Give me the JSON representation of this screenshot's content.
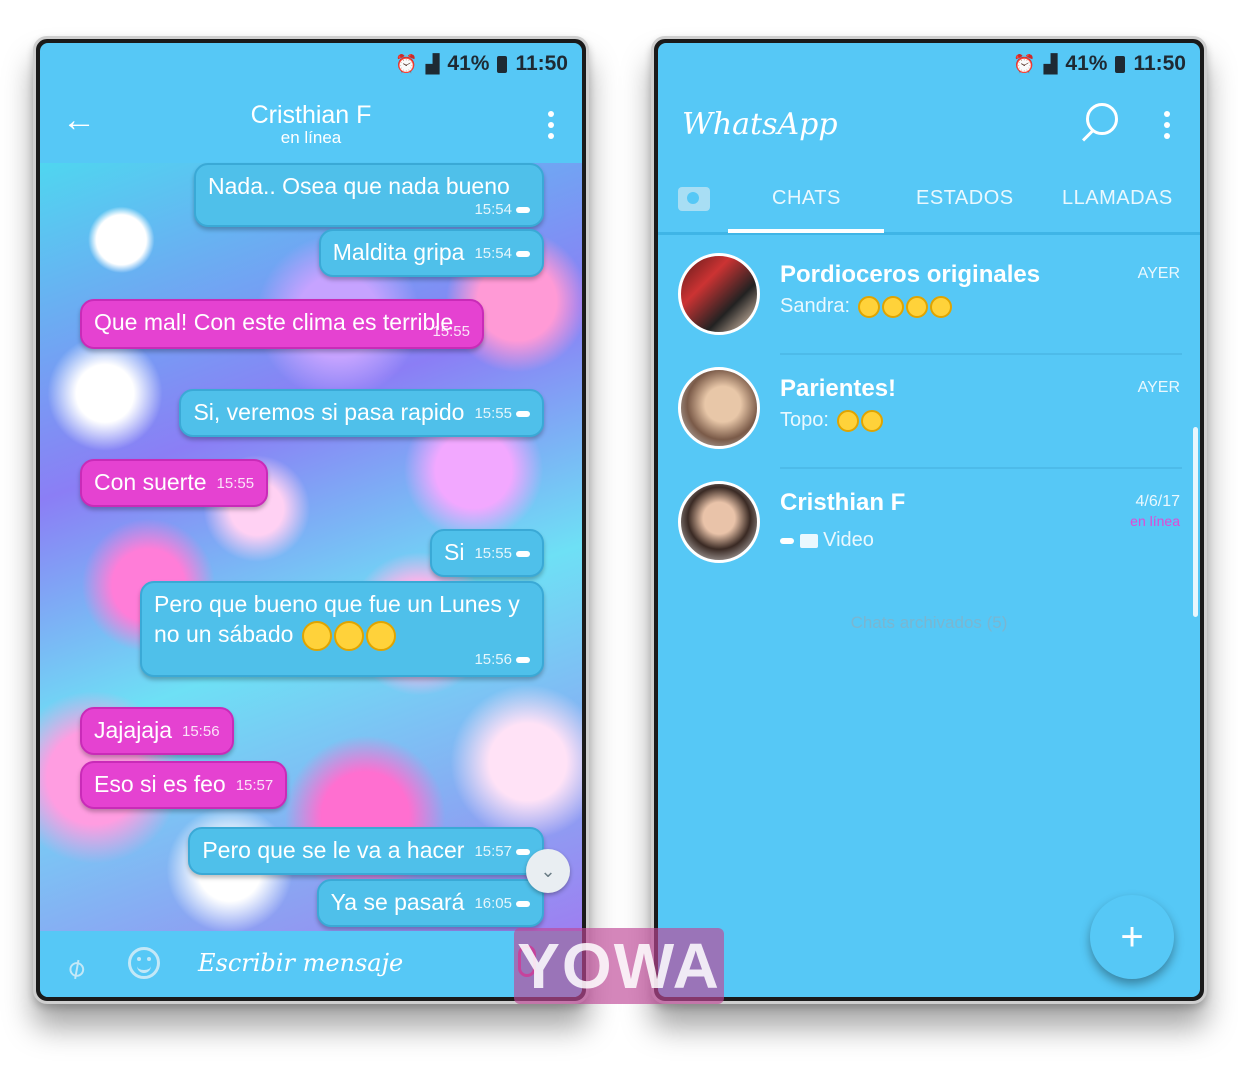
{
  "status_bar": {
    "battery": "41%",
    "time": "11:50"
  },
  "chat_screen": {
    "contact_name": "Cristhian F",
    "contact_status": "en línea",
    "composer_placeholder": "Escribir mensaje",
    "messages": [
      {
        "text": "Nada.. Osea que nada bueno",
        "time": "15:54",
        "direction": "out"
      },
      {
        "text": "Maldita gripa",
        "time": "15:54",
        "direction": "out"
      },
      {
        "text": "Que mal! Con este clima es terrible",
        "time": "15:55",
        "direction": "in"
      },
      {
        "text": "Si, veremos si pasa rapido",
        "time": "15:55",
        "direction": "out"
      },
      {
        "text": "Con suerte",
        "time": "15:55",
        "direction": "in"
      },
      {
        "text": "Si",
        "time": "15:55",
        "direction": "out"
      },
      {
        "text": "Pero que bueno que fue un Lunes y no un sábado",
        "time": "15:56",
        "direction": "out"
      },
      {
        "text": "Jajajaja",
        "time": "15:56",
        "direction": "in"
      },
      {
        "text": "Eso si es feo",
        "time": "15:57",
        "direction": "in"
      },
      {
        "text": "Pero que se le va a hacer",
        "time": "15:57",
        "direction": "out"
      },
      {
        "text": "Ya se pasará",
        "time": "16:05",
        "direction": "out"
      }
    ]
  },
  "home_screen": {
    "app_title": "WhatsApp",
    "tabs": [
      "CHATS",
      "ESTADOS",
      "LLAMADAS"
    ],
    "chats": [
      {
        "name": "Pordioceros originales",
        "preview": "Sandra:",
        "time": "AYER"
      },
      {
        "name": "Parientes!",
        "preview": "Topo:",
        "time": "AYER"
      },
      {
        "name": "Cristhian F",
        "preview": "Video",
        "time": "4/6/17",
        "sub": "en línea"
      }
    ],
    "archived": "Chats archivados (5)",
    "fab_label": "+"
  },
  "watermark": "YOWA",
  "colors": {
    "accent": "#56c8f6",
    "incoming": "#e542d1",
    "outgoing": "#4fc0ea"
  }
}
